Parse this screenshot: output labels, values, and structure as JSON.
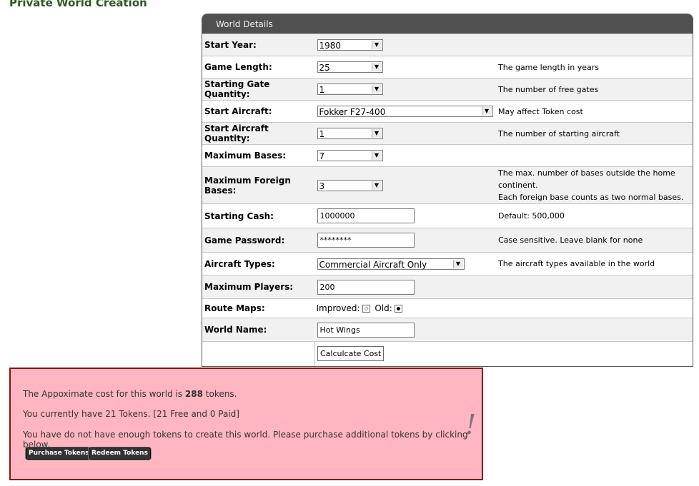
{
  "page": {
    "title": "Private World Creation"
  },
  "panel": {
    "header": "World Details"
  },
  "form": {
    "start_year": {
      "label": "Start Year:",
      "value": "1980"
    },
    "game_length": {
      "label": "Game Length:",
      "value": "25",
      "desc": "The game length in years"
    },
    "starting_gate_quantity": {
      "label": "Starting Gate Quantity:",
      "value": "1",
      "desc": "The number of free gates"
    },
    "start_aircraft": {
      "label": "Start Aircraft:",
      "value": "Fokker F27-400",
      "desc": "May affect Token cost"
    },
    "start_aircraft_quantity": {
      "label": "Start Aircraft Quantity:",
      "value": "1",
      "desc": "The number of starting aircraft"
    },
    "maximum_bases": {
      "label": "Maximum Bases:",
      "value": "7"
    },
    "maximum_foreign_bases": {
      "label": "Maximum Foreign Bases:",
      "value": "3",
      "desc_line1": "The max. number of bases outside the home continent.",
      "desc_line2": "Each foreign base counts as two normal bases."
    },
    "starting_cash": {
      "label": "Starting Cash:",
      "value": "1000000",
      "desc": "Default: 500,000"
    },
    "game_password": {
      "label": "Game Password:",
      "value": "********",
      "desc": "Case sensitive. Leave blank for none"
    },
    "aircraft_types": {
      "label": "Aircraft Types:",
      "value": "Commercial Aircraft Only",
      "desc": "The aircraft types available in the world"
    },
    "maximum_players": {
      "label": "Maximum Players:",
      "value": "200"
    },
    "route_maps": {
      "label": "Route Maps:",
      "improved_label": "Improved:",
      "old_label": "Old:",
      "selected": "Old"
    },
    "world_name": {
      "label": "World Name:",
      "value": "Hot Wings"
    },
    "calculate_button": "Calculcate Cost"
  },
  "notice": {
    "cost_prefix": "The Appoximate cost for this world is ",
    "cost_value": "288",
    "cost_suffix": " tokens.",
    "current_tokens": "You currently have 21 Tokens. [21 Free and 0 Paid]",
    "insufficient": "You have do not have enough tokens to create this world. Please purchase additional tokens by clicking below.",
    "exclamation": "!",
    "purchase_button": "Purchase Tokens",
    "redeem_button": "Redeem Tokens"
  },
  "colors": {
    "title": "#2d5a1f",
    "panel_header": "#505050",
    "notice_bg": "#ffb6c1",
    "notice_border": "#8b1010"
  },
  "icons": {
    "dropdown": "chevron-down-icon",
    "warning": "exclamation-icon"
  }
}
